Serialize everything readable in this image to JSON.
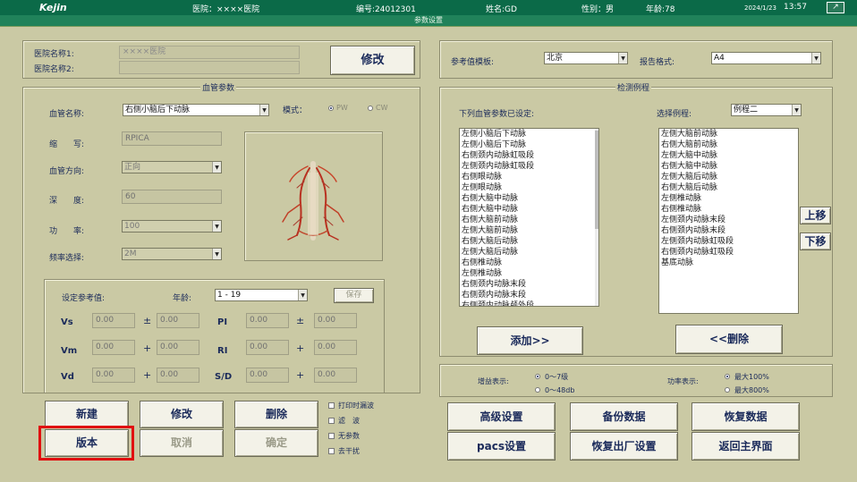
{
  "header": {
    "logo": "Kejin",
    "hospital": "医院：××××医院",
    "number": "编号:24012301",
    "name": "姓名:GD",
    "gender": "性别：男",
    "age": "年龄:78",
    "date": "2024/1/23",
    "time": "13:57",
    "corner_icon": "arrow-icon",
    "corner_glyph": "↗"
  },
  "subtitle": "参数设置",
  "hospital_section": {
    "name1_label": "医院名称1:",
    "name1_value": "××××医院",
    "name2_label": "医院名称2:",
    "name2_value": "",
    "modify_button": "修改"
  },
  "vessel_params": {
    "title": "血管参数",
    "vessel_name_label": "血管名称:",
    "vessel_name_value": "右侧小脑后下动脉",
    "mode_label": "模式：",
    "mode_pw": "PW",
    "mode_cw": "CW",
    "abbr_label": "缩　　写:",
    "abbr_value": "RPICA",
    "direction_label": "血管方向:",
    "direction_value": "正向",
    "depth_label": "深　　度:",
    "depth_value": "60",
    "power_label": "功　　率:",
    "power_value": "100",
    "freq_label": "频率选择:",
    "freq_value": "2M",
    "ref_label": "设定参考值:",
    "age_label": "年龄:",
    "age_value": "1 - 19",
    "save_button": "保存",
    "vs_label": "Vs",
    "vm_label": "Vm",
    "vd_label": "Vd",
    "pi_label": "PI",
    "ri_label": "RI",
    "sd_label": "S/D",
    "pm_sign": "±",
    "plus_sign": "+",
    "zero": "0.00"
  },
  "action_buttons": {
    "new": "新建",
    "modify": "修改",
    "delete": "删除",
    "version": "版本",
    "cancel": "取消",
    "confirm": "确定"
  },
  "checkboxes": {
    "print_wave": "打印时漏波",
    "filter": "滤　波",
    "no_param": "无参数",
    "anti_interference": "去干扰"
  },
  "reference": {
    "template_label": "参考值模板:",
    "template_value": "北京",
    "report_label": "报告格式:",
    "report_value": "A4"
  },
  "detection": {
    "title": "检测例程",
    "set_label": "下列血管参数已设定:",
    "select_label": "选择例程:",
    "select_value": "例程二",
    "left_list": [
      "左侧小脑后下动脉",
      "左侧小脑后下动脉",
      "右侧颈内动脉虹吸段",
      "左侧颈内动脉虹吸段",
      "右侧眼动脉",
      "左侧眼动脉",
      "右侧大脑中动脉",
      "右侧大脑中动脉",
      "右侧大脑前动脉",
      "左侧大脑前动脉",
      "右侧大脑后动脉",
      "左侧大脑后动脉",
      "右侧椎动脉",
      "左侧椎动脉",
      "右侧颈内动脉末段",
      "右侧颈内动脉末段",
      "右侧颈内动脉颅外段"
    ],
    "right_list": [
      "左侧大脑前动脉",
      "右侧大脑前动脉",
      "左侧大脑中动脉",
      "右侧大脑中动脉",
      "左侧大脑后动脉",
      "右侧大脑后动脉",
      "左侧椎动脉",
      "右侧椎动脉",
      "左侧颈内动脉末段",
      "右侧颈内动脉末段",
      "左侧颈内动脉虹吸段",
      "右侧颈内动脉虹吸段",
      "基底动脉"
    ],
    "up_button": "上移",
    "down_button": "下移",
    "add_button": "添加>>",
    "remove_button": "<<删除"
  },
  "display": {
    "gain_label": "增益表示:",
    "gain_opt1": "0～7级",
    "gain_opt2": "0～48db",
    "power_label": "功率表示:",
    "power_opt1": "最大100%",
    "power_opt2": "最大800%"
  },
  "bottom_buttons": {
    "advanced": "高级设置",
    "backup": "备份数据",
    "restore": "恢复数据",
    "pacs": "pacs设置",
    "factory": "恢复出厂设置",
    "return_main": "返回主界面"
  },
  "colors": {
    "background": "#cac9a4",
    "header": "#0b6a48",
    "highlight": "#e01010"
  }
}
